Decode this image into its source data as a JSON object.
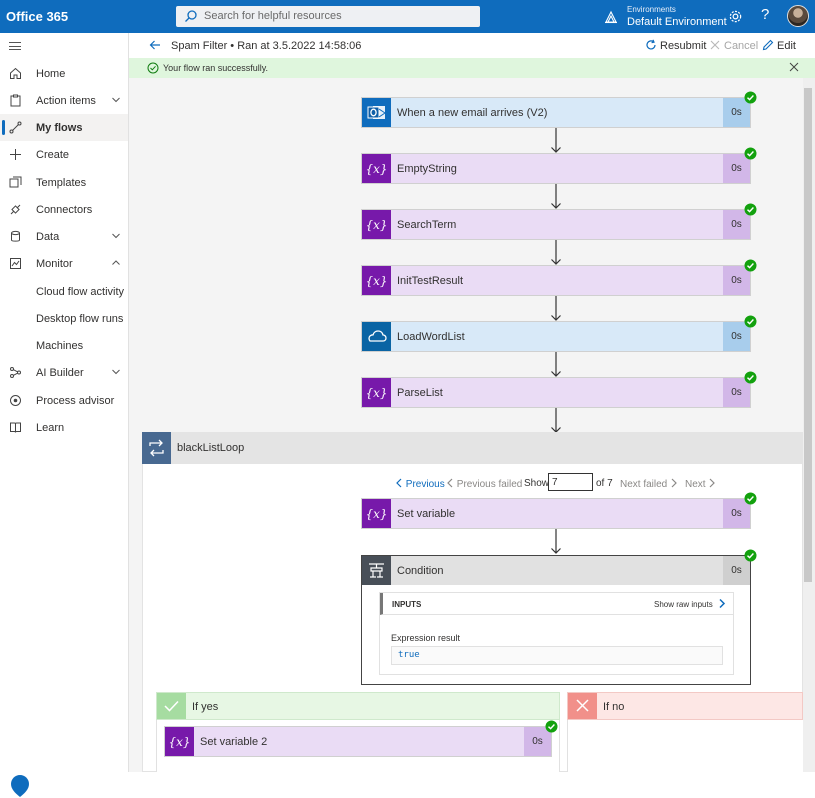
{
  "app": {
    "brand": "Office 365"
  },
  "search": {
    "placeholder": "Search for helpful resources"
  },
  "environment": {
    "label": "Environments",
    "name": "Default Environment"
  },
  "colors": {
    "brand": "#0f6cbd",
    "variable": "#7719aa",
    "success_bg": "#dff6dd",
    "yes": "#e7f7e4",
    "no": "#fde7e5"
  },
  "sidebar": {
    "items": [
      {
        "label": "Home",
        "icon": "home-icon"
      },
      {
        "label": "Action items",
        "icon": "clipboard-icon",
        "expandable": true
      },
      {
        "label": "My flows",
        "icon": "flow-icon",
        "active": true
      },
      {
        "label": "Create",
        "icon": "plus-icon"
      },
      {
        "label": "Templates",
        "icon": "templates-icon"
      },
      {
        "label": "Connectors",
        "icon": "connector-icon"
      },
      {
        "label": "Data",
        "icon": "database-icon",
        "expandable": true
      },
      {
        "label": "Monitor",
        "icon": "monitor-icon",
        "expandable": true,
        "expanded": true
      },
      {
        "label": "Cloud flow activity"
      },
      {
        "label": "Desktop flow runs"
      },
      {
        "label": "Machines"
      },
      {
        "label": "AI Builder",
        "icon": "ai-icon",
        "expandable": true
      },
      {
        "label": "Process advisor",
        "icon": "process-icon"
      },
      {
        "label": "Learn",
        "icon": "book-icon"
      }
    ]
  },
  "header": {
    "breadcrumb": "Spam Filter • Ran at 3.5.2022 14:58:06",
    "resubmit": "Resubmit",
    "cancel": "Cancel",
    "edit": "Edit"
  },
  "banner": {
    "message": "Your flow ran successfully."
  },
  "flow": {
    "steps": [
      {
        "title": "When a new email arrives (V2)",
        "duration": "0s",
        "kind": "outlook"
      },
      {
        "title": "EmptyString",
        "duration": "0s",
        "kind": "variable"
      },
      {
        "title": "SearchTerm",
        "duration": "0s",
        "kind": "variable"
      },
      {
        "title": "InitTestResult",
        "duration": "0s",
        "kind": "variable"
      },
      {
        "title": "LoadWordList",
        "duration": "0s",
        "kind": "onedrive"
      },
      {
        "title": "ParseList",
        "duration": "0s",
        "kind": "variable"
      }
    ],
    "loop": {
      "title": "blackListLoop",
      "pager": {
        "previous": "Previous",
        "previous_failed": "Previous failed",
        "show": "Show",
        "current": "7",
        "of_total": "of 7",
        "next_failed": "Next failed",
        "next": "Next"
      },
      "set_variable": {
        "title": "Set variable",
        "duration": "0s"
      },
      "condition": {
        "title": "Condition",
        "duration": "0s",
        "inputs_label": "INPUTS",
        "show_raw": "Show raw inputs",
        "expression_label": "Expression result",
        "expression_value": "true"
      },
      "if_yes": {
        "title": "If yes",
        "step": {
          "title": "Set variable 2",
          "duration": "0s"
        }
      },
      "if_no": {
        "title": "If no"
      }
    }
  }
}
